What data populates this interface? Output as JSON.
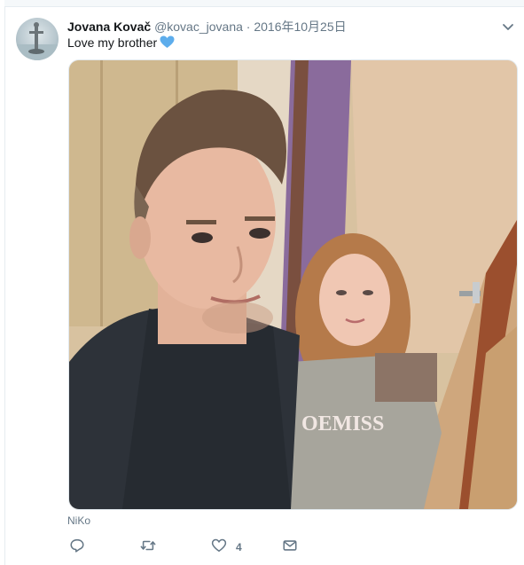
{
  "tweet": {
    "display_name": "Jovana Kovač",
    "handle": "@kovac_jovana",
    "separator": "·",
    "date": "2016年10月25日",
    "text": "Love my brother",
    "text_emoji": "blue-heart-emoji",
    "media_alt": "selfie photo",
    "tagged_user": "NiKo"
  },
  "actions": {
    "reply_icon": "reply-icon",
    "retweet_icon": "retweet-icon",
    "like_icon": "heart-icon",
    "like_count": "4",
    "dm_icon": "envelope-icon",
    "more_icon": "chevron-down-icon"
  },
  "colors": {
    "accent": "#1da1f2",
    "text_primary": "#14171a",
    "text_secondary": "#657786",
    "heart_emoji": "#5dadec"
  }
}
